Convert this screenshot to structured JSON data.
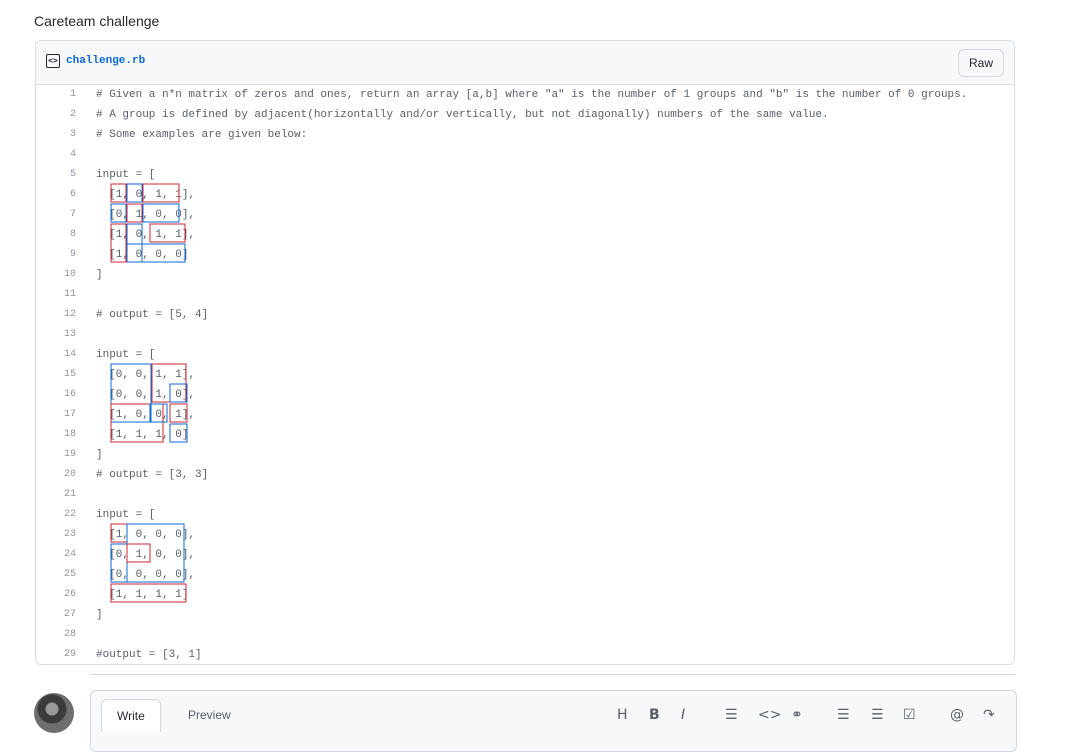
{
  "page": {
    "title": "Careteam challenge"
  },
  "file": {
    "name": "challenge.rb",
    "raw_label": "Raw"
  },
  "code_lines": [
    "# Given a n*n matrix of zeros and ones, return an array [a,b] where \"a\" is the number of 1 groups and \"b\" is the number of 0 groups.",
    "# A group is defined by adjacent(horizontally and/or vertically, but not diagonally) numbers of the same value.",
    "# Some examples are given below:",
    "",
    "input = [",
    "  [1, 0, 1, 1],",
    "  [0, 1, 0, 0],",
    "  [1, 0, 1, 1],",
    "  [1, 0, 0, 0]",
    "]",
    "",
    "# output = [5, 4]",
    "",
    "input = [",
    "  [0, 0, 1, 1],",
    "  [0, 0, 1, 0],",
    "  [1, 0, 0, 1],",
    "  [1, 1, 1, 0]",
    "]",
    "# output = [3, 3]",
    "",
    "input = [",
    "  [1, 0, 0, 0],",
    "  [0, 1, 0, 0],",
    "  [0, 0, 0, 0],",
    "  [1, 1, 1, 1]",
    "]",
    "",
    "#output = [3, 1]"
  ],
  "comment": {
    "tabs": [
      "Write",
      "Preview"
    ],
    "toolbar": [
      "H",
      "B",
      "I",
      "☰",
      "<>",
      "⚭",
      "☰",
      "☰",
      "☑",
      "@",
      "↷"
    ]
  },
  "colors": {
    "ones_group": "#d1242f",
    "zeros_group": "#0969da"
  }
}
